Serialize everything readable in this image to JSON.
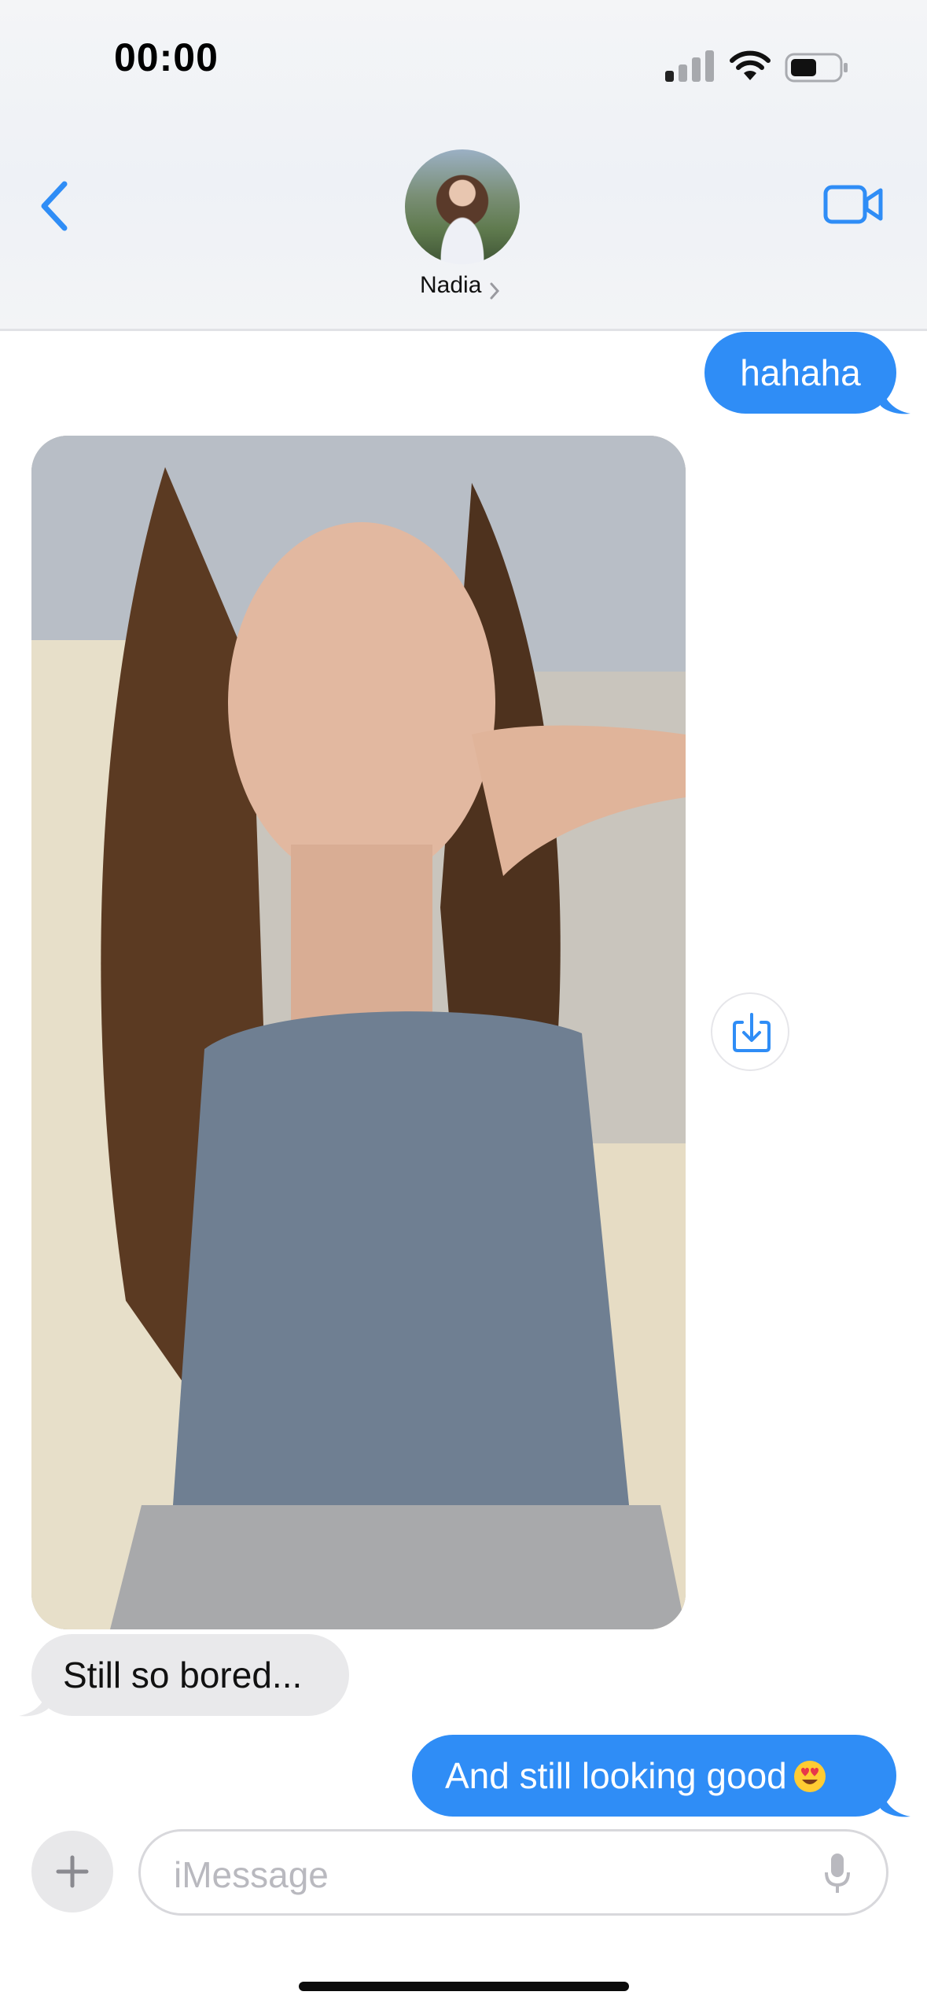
{
  "status_bar": {
    "time": "00:00"
  },
  "header": {
    "contact_name": "Nadia",
    "back_icon": "chevron-left-icon",
    "video_icon": "video-camera-icon"
  },
  "messages": [
    {
      "direction": "outgoing",
      "text": "hahaha"
    },
    {
      "direction": "incoming",
      "type": "photo"
    },
    {
      "direction": "incoming",
      "text": "Still so bored..."
    },
    {
      "direction": "outgoing",
      "text": "And still looking good",
      "emoji": "heart-eyes"
    }
  ],
  "composer": {
    "placeholder": "iMessage",
    "add_icon": "plus-icon",
    "mic_icon": "microphone-icon"
  },
  "colors": {
    "accent": "#2f8df6",
    "incoming_bubble": "#e9e9eb",
    "outgoing_bubble": "#2f8df6"
  }
}
